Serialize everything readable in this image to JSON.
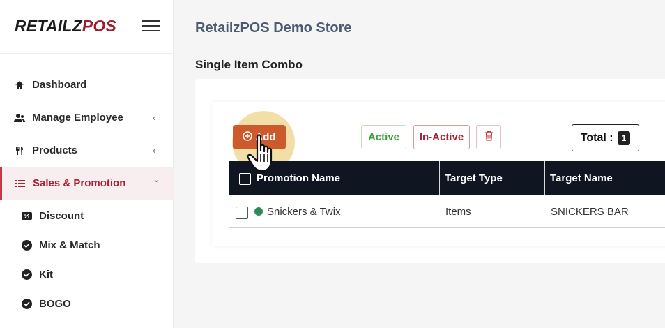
{
  "brand": {
    "logo_part1": "RETAILZ",
    "logo_part2": "POS"
  },
  "sidebar": {
    "items": [
      {
        "label": "Dashboard",
        "icon": "home-icon",
        "has_chevron": false
      },
      {
        "label": "Manage Employee",
        "icon": "users-icon",
        "chevron": "‹"
      },
      {
        "label": "Products",
        "icon": "utensils-icon",
        "chevron": "‹"
      },
      {
        "label": "Sales & Promotion",
        "icon": "list-icon",
        "chevron": "⌄",
        "active": true
      }
    ],
    "subitems": [
      {
        "label": "Discount",
        "icon": "ticket-icon"
      },
      {
        "label": "Mix & Match",
        "icon": "check-badge-icon"
      },
      {
        "label": "Kit",
        "icon": "check-badge-icon"
      },
      {
        "label": "BOGO",
        "icon": "check-badge-icon"
      }
    ]
  },
  "header": {
    "store_title": "RetailzPOS Demo Store"
  },
  "page": {
    "title": "Single Item Combo"
  },
  "toolbar": {
    "add_label": "Add",
    "active_label": "Active",
    "inactive_label": "In-Active",
    "total_label": "Total :",
    "total_count": "1"
  },
  "table": {
    "columns": [
      "Promotion Name",
      "Target Type",
      "Target Name"
    ],
    "rows": [
      {
        "promotion_name": "Snickers & Twix",
        "target_type": "Items",
        "target_name": "SNICKERS BAR",
        "status": "active"
      }
    ]
  },
  "colors": {
    "accent": "#a82231",
    "add_button": "#cc5a2d",
    "table_header": "#101522",
    "active_green": "#3aa23a",
    "status_dot": "#2e8b57"
  }
}
